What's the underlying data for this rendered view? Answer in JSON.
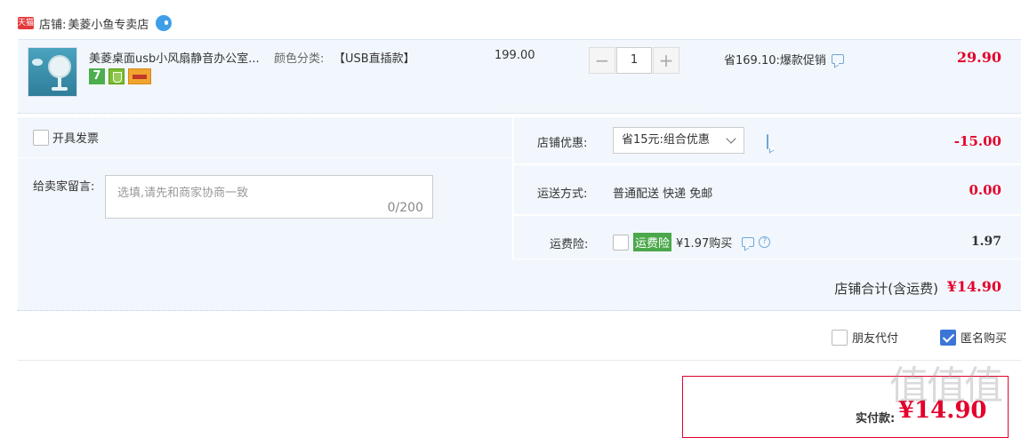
{
  "store": {
    "badge": "天猫",
    "label": "店铺:",
    "name": "美菱小鱼专卖店"
  },
  "item": {
    "title": "美菱桌面usb小风扇静音办公室...",
    "variant_label": "颜色分类:",
    "variant_value": "【USB直插款】",
    "badge_7": "7",
    "original_price": "199.00",
    "quantity": "1",
    "minus": "−",
    "plus": "+",
    "discount": "省169.10:爆款促销",
    "total": "29.90"
  },
  "options": {
    "invoice_label": "开具发票",
    "message_label": "给卖家留言:",
    "message_placeholder": "选填,请先和商家协商一致",
    "message_count": "0/200",
    "shop_discount_label": "店铺优惠:",
    "shop_discount_value": "省15元:组合优惠",
    "shop_discount_amount": "-15.00",
    "shipping_label": "运送方式:",
    "shipping_value": "普通配送 快递 免邮",
    "shipping_amount": "0.00",
    "insurance_label": "运费险:",
    "insurance_tag": "运费险",
    "insurance_value": "¥1.97购买",
    "insurance_amount": "1.97",
    "q_mark": "?"
  },
  "shop_total": {
    "label": "店铺合计(含运费)",
    "value": "¥14.90"
  },
  "checkout": {
    "friend_pay": "朋友代付",
    "anonymous": "匿名购买",
    "pay_label": "实付款:",
    "pay_amount": "¥14.90"
  },
  "watermark": "值值值",
  "colors": {
    "accent_red": "#e4002b",
    "panel_blue": "#f2f7fd",
    "check_blue": "#3b76d6"
  }
}
